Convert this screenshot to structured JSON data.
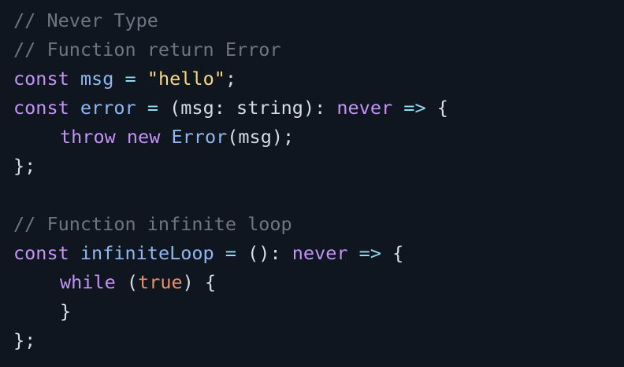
{
  "code": {
    "line1": {
      "comment": "// Never Type"
    },
    "line2": {
      "comment": "// Function return Error"
    },
    "line3": {
      "kw": "const",
      "name": "msg",
      "op": "=",
      "string": "\"hello\"",
      "end": ";"
    },
    "line4": {
      "kw": "const",
      "name": "error",
      "op": "=",
      "open": "(",
      "param": "msg",
      "colon": ":",
      "param_type": "string",
      "close": "):",
      "ret_type": "never",
      "arrow": "=>",
      "brace": "{"
    },
    "line5": {
      "kw_throw": "throw",
      "kw_new": "new",
      "cls": "Error",
      "args": "(msg);"
    },
    "line6": {
      "text": "};"
    },
    "line8": {
      "comment": "// Function infinite loop"
    },
    "line9": {
      "kw": "const",
      "name": "infiniteLoop",
      "op": "=",
      "parens": "():",
      "ret_type": "never",
      "arrow": "=>",
      "brace": "{"
    },
    "line10": {
      "kw_while": "while",
      "open": "(",
      "bool": "true",
      "close": ")",
      "brace": "{"
    },
    "line11": {
      "text": "}"
    },
    "line12": {
      "text": "};"
    }
  },
  "colors": {
    "background": "#0f1620",
    "comment": "#6c7582",
    "keyword": "#c392f5",
    "identifier": "#8fb6ee",
    "operator": "#8fdbf0",
    "string": "#f6d784",
    "boolean": "#f08e63",
    "text": "#d6dbe5"
  }
}
